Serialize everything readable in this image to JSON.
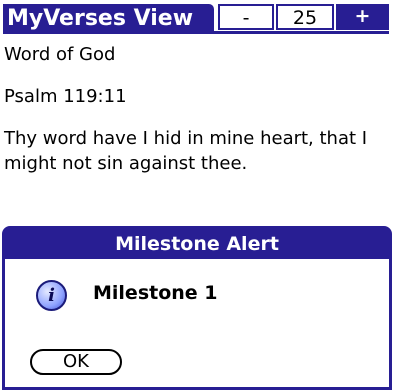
{
  "app": {
    "title": "MyVerses View"
  },
  "controls": {
    "minus_label": "-",
    "count": "25",
    "plus_label": "+"
  },
  "content": {
    "heading": "Word of God",
    "reference": "Psalm 119:11",
    "verse": "Thy word have I hid in mine heart, that I might not sin against thee."
  },
  "dialog": {
    "title": "Milestone Alert",
    "icon": "info-icon",
    "message": "Milestone 1",
    "ok_label": "OK"
  },
  "colors": {
    "accent": "#281e93",
    "background": "#ffffff"
  }
}
